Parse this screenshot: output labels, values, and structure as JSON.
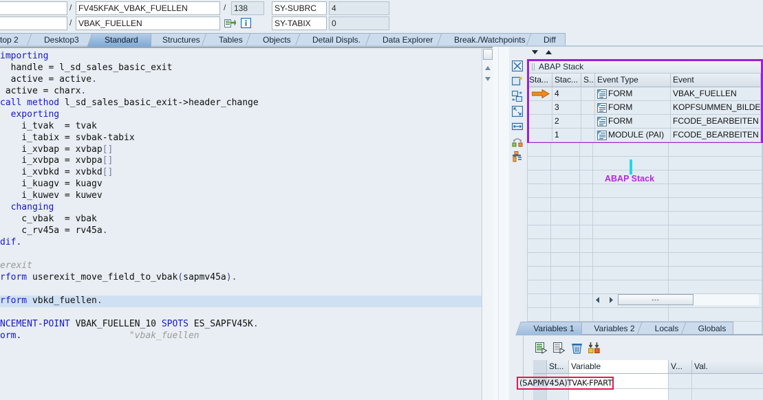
{
  "header": {
    "field_empty_1": "",
    "field_empty_2": "",
    "separator": "/",
    "program_value": "FV45KFAK_VBAK_FUELLEN",
    "line_value": "138",
    "form_value": "VBAK_FUELLEN",
    "sy_subrc_label": "SY-SUBRC",
    "sy_subrc_value": "4",
    "sy_tabix_label": "SY-TABIX",
    "sy_tabix_value": "0",
    "goto_icon": "goto-source-icon",
    "info_icon": "info-icon"
  },
  "tabs": [
    {
      "label": "top 2",
      "active": false
    },
    {
      "label": "Desktop3",
      "active": false
    },
    {
      "label": "Standard",
      "active": true
    },
    {
      "label": "Structures",
      "active": false
    },
    {
      "label": "Tables",
      "active": false
    },
    {
      "label": "Objects",
      "active": false
    },
    {
      "label": "Detail Displs.",
      "active": false
    },
    {
      "label": "Data Explorer",
      "active": false
    },
    {
      "label": "Break./Watchpoints",
      "active": false
    },
    {
      "label": "Diff",
      "active": false
    }
  ],
  "code": {
    "lines": [
      {
        "text": "importing",
        "kind": "kw",
        "highlight": false
      },
      {
        "text": "  handle = l_sd_sales_basic_exit",
        "kind": "plain",
        "highlight": false
      },
      {
        "text": "  active = active.",
        "kind": "plain",
        "highlight": false
      },
      {
        "text": " active = charx.",
        "kind": "plain",
        "highlight": false
      },
      {
        "text": "call method l_sd_sales_basic_exit->header_change",
        "kind": "kwstart",
        "highlight": false
      },
      {
        "text": "  exporting",
        "kind": "kw",
        "highlight": false
      },
      {
        "text": "    i_tvak  = tvak",
        "kind": "plain",
        "highlight": false
      },
      {
        "text": "    i_tabix = svbak-tabix",
        "kind": "plain",
        "highlight": false
      },
      {
        "text": "    i_xvbap = xvbap[]",
        "kind": "plain",
        "highlight": false
      },
      {
        "text": "    i_xvbpa = xvbpa[]",
        "kind": "plain",
        "highlight": false
      },
      {
        "text": "    i_xvbkd = xvbkd[]",
        "kind": "plain",
        "highlight": false
      },
      {
        "text": "    i_kuagv = kuagv",
        "kind": "plain",
        "highlight": false
      },
      {
        "text": "    i_kuwev = kuwev",
        "kind": "plain",
        "highlight": false
      },
      {
        "text": "  changing",
        "kind": "kw",
        "highlight": false
      },
      {
        "text": "    c_vbak  = vbak",
        "kind": "plain",
        "highlight": false
      },
      {
        "text": "    c_rv45a = rv45a.",
        "kind": "plain",
        "highlight": false
      },
      {
        "text": "dif.",
        "kind": "kw",
        "highlight": false
      },
      {
        "text": "",
        "kind": "plain",
        "highlight": false
      },
      {
        "text": "erexit",
        "kind": "comment",
        "highlight": false
      },
      {
        "text": "rform userexit_move_field_to_vbak(sapmv45a).",
        "kind": "kwstart",
        "highlight": false
      },
      {
        "text": "",
        "kind": "plain",
        "highlight": false
      },
      {
        "text": "rform vbkd_fuellen.",
        "kind": "kwstart",
        "highlight": true
      },
      {
        "text": "",
        "kind": "plain",
        "highlight": false
      },
      {
        "text": "NCEMENT-POINT VBAK_FUELLEN_10 SPOTS ES_SAPFV45K.",
        "kind": "kwstart",
        "highlight": false
      },
      {
        "text": "orm.                    \"vbak_fuellen",
        "kind": "endform",
        "highlight": false
      }
    ]
  },
  "stack": {
    "panel_title": "ABAP Stack",
    "annotation_label": "ABAP Stack",
    "annotation_color": "#b527e0",
    "border_color": "#9b1fd8",
    "pointer_color": "#23d7e8",
    "columns": [
      "Sta...",
      "Stac...",
      "S..",
      "Event Type",
      "Event"
    ],
    "rows": [
      {
        "marker": "current-position-arrow",
        "stack": "4",
        "doc_icon": "program-doc-icon",
        "event_type": "FORM",
        "event": "VBAK_FUELLEN"
      },
      {
        "marker": "",
        "stack": "3",
        "doc_icon": "program-doc-icon",
        "event_type": "FORM",
        "event": "KOPFSUMMEN_BILDEN"
      },
      {
        "marker": "",
        "stack": "2",
        "doc_icon": "program-doc-icon",
        "event_type": "FORM",
        "event": "FCODE_BEARBEITEN"
      },
      {
        "marker": "",
        "stack": "1",
        "doc_icon": "program-doc-icon",
        "event_type": "MODULE (PAI)",
        "event": "FCODE_BEARBEITEN"
      }
    ],
    "sort_down_icon": "sort-down-icon",
    "sort_up_icon": "sort-up-icon",
    "scroll_left_icon": "scroll-left-arrow",
    "scroll_right_icon": "scroll-right-arrow"
  },
  "vtoolbar": [
    {
      "icon": "close-session-icon"
    },
    {
      "icon": "new-window-icon"
    },
    {
      "icon": "swap-layout-icon"
    },
    {
      "icon": "maximize-icon"
    },
    {
      "icon": "resize-width-icon"
    },
    {
      "icon": "switch-tools-icon"
    },
    {
      "icon": "service-tools-icon"
    }
  ],
  "variables": {
    "tabs": [
      {
        "label": "Variables 1",
        "active": true
      },
      {
        "label": "Variables 2",
        "active": false
      },
      {
        "label": "Locals",
        "active": false
      },
      {
        "label": "Globals",
        "active": false
      }
    ],
    "toolbar": [
      {
        "icon": "insert-variable-icon"
      },
      {
        "icon": "copy-variable-icon"
      },
      {
        "icon": "delete-variable-icon"
      },
      {
        "icon": "collapse-all-icon"
      }
    ],
    "columns": [
      "",
      "St...",
      "Variable",
      "V...",
      "Val."
    ],
    "rows": [
      {
        "st": "",
        "variable": "(SAPMV45A)TVAK-FPART",
        "v": "",
        "val": "",
        "highlight": true
      }
    ],
    "highlight_color": "#e8184f"
  }
}
